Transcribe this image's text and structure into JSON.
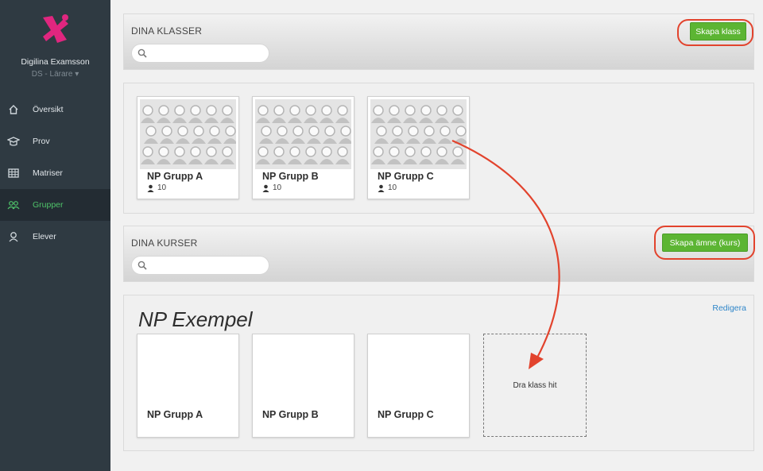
{
  "sidebar": {
    "user_name": "Digilina Examsson",
    "user_role": "DS - Lärare ▾",
    "items": [
      {
        "label": "Översikt",
        "icon": "home-icon",
        "active": false
      },
      {
        "label": "Prov",
        "icon": "graduation-cap-icon",
        "active": false
      },
      {
        "label": "Matriser",
        "icon": "table-icon",
        "active": false
      },
      {
        "label": "Grupper",
        "icon": "users-icon",
        "active": true
      },
      {
        "label": "Elever",
        "icon": "user-icon",
        "active": false
      }
    ]
  },
  "classes": {
    "title": "DINA KLASSER",
    "search_placeholder": "",
    "create_button": "Skapa klass",
    "cards": [
      {
        "name": "NP Grupp A",
        "count": "10"
      },
      {
        "name": "NP Grupp B",
        "count": "10"
      },
      {
        "name": "NP Grupp C",
        "count": "10"
      }
    ]
  },
  "courses": {
    "title": "DINA KURSER",
    "search_placeholder": "",
    "create_button": "Skapa ämne (kurs)",
    "course": {
      "name": "NP Exempel",
      "edit_label": "Redigera",
      "groups": [
        "NP Grupp A",
        "NP Grupp B",
        "NP Grupp C"
      ],
      "dropzone_label": "Dra klass hit"
    }
  },
  "colors": {
    "sidebar": "#2f3a42",
    "accent_green": "#5cb533",
    "active_nav": "#4fc36a",
    "annotation_red": "#e2432d",
    "link": "#2f86c9"
  }
}
